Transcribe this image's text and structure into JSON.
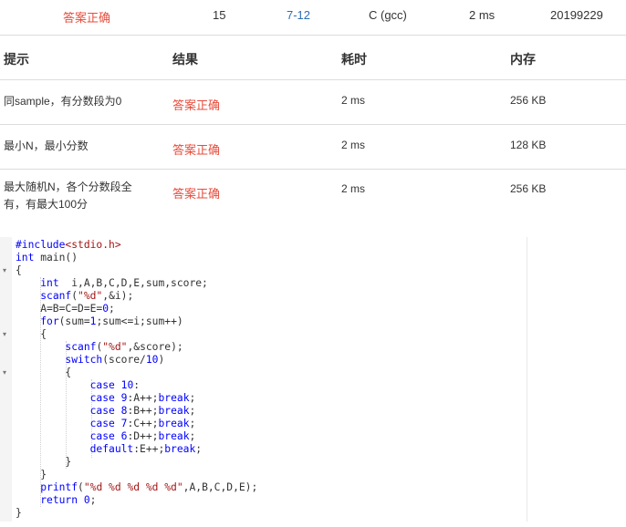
{
  "summary": {
    "status": "答案正确",
    "score": "15",
    "problem": "7-12",
    "compiler": "C (gcc)",
    "time": "2 ms",
    "user": "20199229"
  },
  "table": {
    "headers": [
      "提示",
      "结果",
      "耗时",
      "内存"
    ],
    "rows": [
      {
        "hint": "同sample，有分数段为0",
        "result": "答案正确",
        "time": "2 ms",
        "memory": "256 KB"
      },
      {
        "hint": "最小N，最小分数",
        "result": "答案正确",
        "time": "2 ms",
        "memory": "128 KB"
      },
      {
        "hint": "最大随机N，各个分数段全有，有最大100分",
        "result": "答案正确",
        "time": "2 ms",
        "memory": "256 KB"
      }
    ]
  },
  "code": {
    "lines": [
      "#include<stdio.h>",
      "int main()",
      "{",
      "    int  i,A,B,C,D,E,sum,score;",
      "    scanf(\"%d\",&i);",
      "    A=B=C=D=E=0;",
      "    for(sum=1;sum<=i;sum++)",
      "    {",
      "        scanf(\"%d\",&score);",
      "        switch(score/10)",
      "        {",
      "            case 10:",
      "            case 9:A++;break;",
      "            case 8:B++;break;",
      "            case 7:C++;break;",
      "            case 6:D++;break;",
      "            default:E++;break;",
      "        }",
      "    }",
      "    printf(\"%d %d %d %d %d\",A,B,C,D,E);",
      "    return 0;",
      "}"
    ]
  },
  "colors": {
    "status_ok": "#e74c3c",
    "link": "#2d6db5",
    "keyword": "#0000ff",
    "string": "#a31515"
  }
}
